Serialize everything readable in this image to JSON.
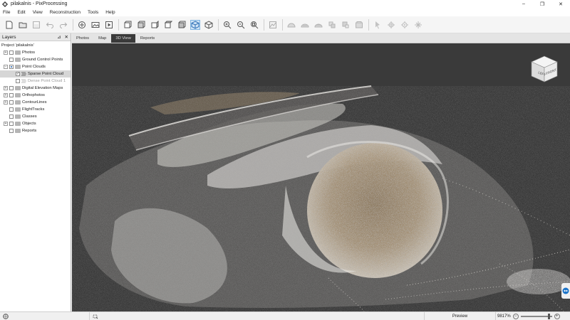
{
  "window": {
    "title": "pilakalnis - PixProcessing",
    "minimize": "–",
    "maximize": "❐",
    "close": "✕"
  },
  "menu": [
    "File",
    "Edit",
    "View",
    "Reconstruction",
    "Tools",
    "Help"
  ],
  "toolbar": {
    "icons": [
      "new-project-icon",
      "open-project-icon",
      "save-project-icon",
      "undo-icon",
      "redo-icon",
      "add-photos-icon",
      "add-images-icon",
      "play-icon",
      "view-front-icon",
      "view-back-icon",
      "view-left-icon",
      "view-right-icon",
      "view-top-icon",
      "view-perspective-icon",
      "view-orthographic-icon",
      "zoom-in-icon",
      "zoom-out-icon",
      "zoom-fit-icon",
      "elevation-icon",
      "terrain-1-icon",
      "terrain-2-icon",
      "terrain-3-icon",
      "terrain-4-icon",
      "terrain-5-icon",
      "terrain-6-icon",
      "measure-point-icon",
      "measure-line-icon",
      "measure-area-icon",
      "measure-volume-icon"
    ],
    "active": "view-perspective-icon"
  },
  "layers": {
    "title": "Layers",
    "pin": "⊿",
    "close": "✕",
    "tree": [
      {
        "label": "Project 'pilakalnis'",
        "level": 0,
        "type": "root"
      },
      {
        "label": "Photos",
        "level": 1,
        "type": "folder",
        "expander": "+"
      },
      {
        "label": "Ground Control Points",
        "level": 1,
        "type": "folder",
        "expander": ""
      },
      {
        "label": "Point Clouds",
        "level": 1,
        "type": "folder",
        "expander": "−",
        "check": "partial"
      },
      {
        "label": "Sparse Point Cloud",
        "level": 2,
        "type": "pointcloud",
        "check": "checked",
        "selected": true
      },
      {
        "label": "Dense Point Cloud 1",
        "level": 2,
        "type": "pointcloud",
        "check": "unchecked",
        "dim": true
      },
      {
        "label": "Digital Elevation Maps",
        "level": 1,
        "type": "folder",
        "expander": "+"
      },
      {
        "label": "Orthophotos",
        "level": 1,
        "type": "folder",
        "expander": "+"
      },
      {
        "label": "ContourLines",
        "level": 1,
        "type": "folder",
        "expander": "+"
      },
      {
        "label": "FlightTracks",
        "level": 1,
        "type": "folder",
        "expander": ""
      },
      {
        "label": "Classes",
        "level": 1,
        "type": "folder",
        "expander": ""
      },
      {
        "label": "Objects",
        "level": 1,
        "type": "folder",
        "expander": "+"
      },
      {
        "label": "Reports",
        "level": 1,
        "type": "folder",
        "expander": ""
      }
    ]
  },
  "tabs": [
    {
      "label": "Photos",
      "active": false
    },
    {
      "label": "Map",
      "active": false
    },
    {
      "label": "3D View",
      "active": true
    },
    {
      "label": "Reports",
      "active": false
    }
  ],
  "viewcube": {
    "left": "LEFT",
    "front": "FRONT"
  },
  "status": {
    "mode": "Preview",
    "zoom": "9817%",
    "zoom_level": 0.92,
    "zoom_out": "−",
    "zoom_in": "+"
  },
  "colors": {
    "viewport_bg": "#3a3a3a",
    "points_light": "#e8e6e2",
    "points_mound": "#a89478",
    "active_tab": "#3a3a3a",
    "selection": "#cfe3f5"
  }
}
